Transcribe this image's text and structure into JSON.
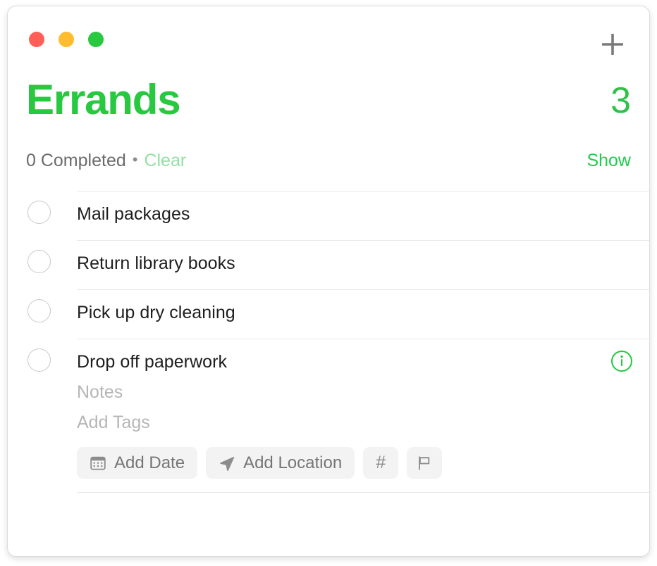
{
  "window": {
    "traffic_lights": [
      {
        "name": "close",
        "color": "#ff5f57"
      },
      {
        "name": "minimize",
        "color": "#febc2e"
      },
      {
        "name": "maximize",
        "color": "#28c840"
      }
    ],
    "add_button": {
      "icon": "plus-icon",
      "label": "+",
      "color": "#7a7a7a"
    }
  },
  "header": {
    "title": "Errands",
    "title_color": "#28c840",
    "count": "3",
    "count_color": "#2ec24a"
  },
  "meta": {
    "completed_text": "0 Completed",
    "separator": "•",
    "clear_label": "Clear",
    "clear_color": "#92e0a4",
    "show_label": "Show",
    "show_color": "#23ca4b"
  },
  "tasks": [
    {
      "title": "Mail packages",
      "completed": false,
      "expanded": false
    },
    {
      "title": "Return library books",
      "completed": false,
      "expanded": false
    },
    {
      "title": "Pick up dry cleaning",
      "completed": false,
      "expanded": false
    },
    {
      "title": "Drop off paperwork",
      "completed": false,
      "expanded": true
    }
  ],
  "detail": {
    "notes_placeholder": "Notes",
    "tags_placeholder": "Add Tags",
    "info_icon": "info-circle-icon",
    "info_icon_color": "#28c840",
    "actions": [
      {
        "name": "add-date-button",
        "icon": "calendar-icon",
        "label": "Add Date"
      },
      {
        "name": "add-location-button",
        "icon": "navigation-icon",
        "label": "Add Location"
      },
      {
        "name": "add-tag-button",
        "icon": "hash-icon",
        "label": "#"
      },
      {
        "name": "add-flag-button",
        "icon": "flag-icon",
        "label": ""
      }
    ]
  }
}
